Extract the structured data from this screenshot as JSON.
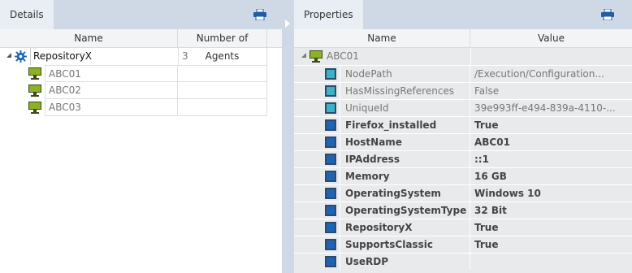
{
  "left_panel": {
    "tab_label": "Details",
    "columns": [
      "Name",
      "Number of Agents"
    ],
    "root": {
      "name": "RepositoryX",
      "agents": "3"
    },
    "children": [
      {
        "name": "ABC01",
        "agents": ""
      },
      {
        "name": "ABC02",
        "agents": ""
      },
      {
        "name": "ABC03",
        "agents": ""
      }
    ]
  },
  "right_panel": {
    "tab_label": "Properties",
    "columns": [
      "Name",
      "Value"
    ],
    "root": {
      "name": "ABC01"
    },
    "properties": [
      {
        "name": "NodePath",
        "value": "/Execution/Configuration...",
        "kind": "system"
      },
      {
        "name": "HasMissingReferences",
        "value": "False",
        "kind": "system"
      },
      {
        "name": "UniqueId",
        "value": "39e993ff-e494-839a-4110-...",
        "kind": "system"
      },
      {
        "name": "Firefox_installed",
        "value": "True",
        "kind": "user"
      },
      {
        "name": "HostName",
        "value": "ABC01",
        "kind": "user"
      },
      {
        "name": "IPAddress",
        "value": "::1",
        "kind": "user"
      },
      {
        "name": "Memory",
        "value": "16 GB",
        "kind": "user"
      },
      {
        "name": "OperatingSystem",
        "value": "Windows 10",
        "kind": "user"
      },
      {
        "name": "OperatingSystemType",
        "value": "32 Bit",
        "kind": "user"
      },
      {
        "name": "RepositoryX",
        "value": "True",
        "kind": "user"
      },
      {
        "name": "SupportsClassic",
        "value": "True",
        "kind": "user"
      },
      {
        "name": "UseRDP",
        "value": "",
        "kind": "user"
      }
    ]
  },
  "colors": {
    "system_icon": "#3bb3c4",
    "user_icon": "#1e64b4",
    "agent_icon": "#8cb224",
    "gear_icon": "#1e64b4"
  },
  "icons": {
    "print": "printer-icon",
    "repo": "gear-icon",
    "agent": "monitor-icon",
    "prop_system": "square-icon-teal",
    "prop_user": "square-icon-blue"
  }
}
